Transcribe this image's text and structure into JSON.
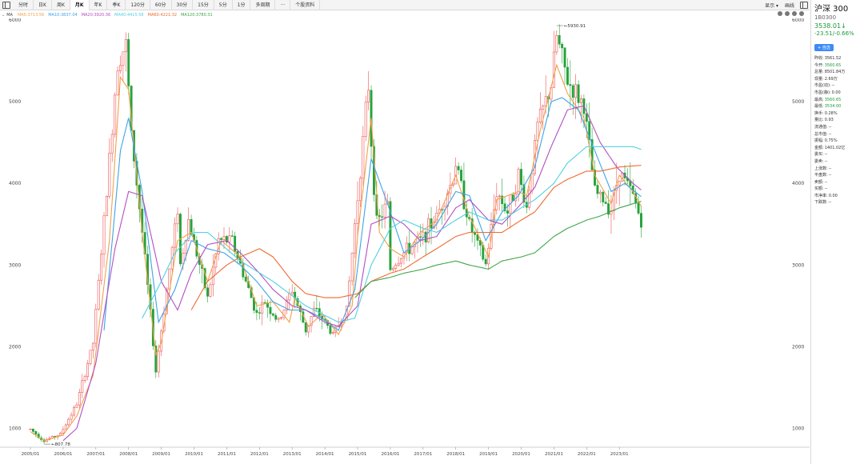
{
  "toolbar": {
    "tabs": [
      "分时",
      "日K",
      "周K",
      "月K",
      "年K",
      "季K",
      "120分",
      "60分",
      "30分",
      "15分",
      "5分",
      "1分",
      "多周期",
      "···",
      "个股资料"
    ],
    "active_index": 3,
    "right": [
      "显示 ▾",
      "画线"
    ]
  },
  "legend": {
    "label": "MA",
    "items": [
      {
        "text": "MA5:3713.56",
        "color": "#f2a14a"
      },
      {
        "text": "MA10:3837.04",
        "color": "#3ea3e8"
      },
      {
        "text": "MA20:3920.36",
        "color": "#b34fc2"
      },
      {
        "text": "MA40:4415.56",
        "color": "#4fd0e0"
      },
      {
        "text": "MA60:4221.32",
        "color": "#ef6a2f"
      },
      {
        "text": "MA120:3780.31",
        "color": "#3fa64a"
      }
    ]
  },
  "side": {
    "name": "沪深 300",
    "code": "1B0300",
    "price": "3538.01↓",
    "change": "-23.51/-0.66%",
    "add_label": "+ 自选",
    "rows": [
      {
        "k": "昨收:",
        "v": "3561.52",
        "green": false
      },
      {
        "k": "今开:",
        "v": "3560.65",
        "green": true
      },
      {
        "k": "总量:",
        "v": "8501.84万",
        "green": false
      },
      {
        "k": "现量:",
        "v": "2.69万",
        "green": false
      },
      {
        "k": "市盈(动):",
        "v": "--",
        "green": false
      },
      {
        "k": "市盈(静):",
        "v": "0.00",
        "green": false
      },
      {
        "k": "最高:",
        "v": "3560.65",
        "green": true
      },
      {
        "k": "最低:",
        "v": "3534.00",
        "green": true
      },
      {
        "k": "换手:",
        "v": "0.28%",
        "green": false
      },
      {
        "k": "量比:",
        "v": "0.93",
        "green": false
      },
      {
        "k": "流通值:",
        "v": "--",
        "green": false
      },
      {
        "k": "总市值:",
        "v": "--",
        "green": false
      },
      {
        "k": "振幅:",
        "v": "0.75%",
        "green": false
      },
      {
        "k": "金额:",
        "v": "1401.02亿",
        "green": false
      },
      {
        "k": "委买:",
        "v": "--",
        "green": false
      },
      {
        "k": "委卖:",
        "v": "--",
        "green": false
      },
      {
        "k": "上涨数:",
        "v": "--",
        "green": false
      },
      {
        "k": "平盘数:",
        "v": "--",
        "green": false
      },
      {
        "k": "卖额:",
        "v": "--",
        "green": false
      },
      {
        "k": "买额:",
        "v": "--",
        "green": false
      },
      {
        "k": "市净率:",
        "v": "0.00",
        "green": false
      },
      {
        "k": "下跌数:",
        "v": "--",
        "green": false
      }
    ]
  },
  "colors": {
    "up": "#ef5350",
    "down": "#26a33b"
  },
  "chart_data": {
    "type": "candlestick",
    "y_ticks": [
      1000,
      2000,
      3000,
      4000,
      5000,
      6000
    ],
    "x_ticks": [
      "2005/01",
      "2006/01",
      "2007/01",
      "2008/01",
      "2009/01",
      "2010/01",
      "2011/01",
      "2012/01",
      "2013/01",
      "2014/01",
      "2015/01",
      "2016/01",
      "2017/01",
      "2018/01",
      "2019/01",
      "2020/01",
      "2021/01",
      "2022/01",
      "2023/01"
    ],
    "annotations": [
      {
        "text": "807.78",
        "date": "2005/06",
        "value": 807.78
      },
      {
        "text": "5930.91",
        "date": "2021/02",
        "value": 5930.91
      }
    ],
    "ma_anchors": {
      "MA5": [
        [
          "2005/01",
          960
        ],
        [
          "2005/06",
          850
        ],
        [
          "2006/01",
          920
        ],
        [
          "2006/06",
          1150
        ],
        [
          "2006/12",
          1650
        ],
        [
          "2007/06",
          3300
        ],
        [
          "2007/10",
          5300
        ],
        [
          "2008/01",
          5150
        ],
        [
          "2008/06",
          3400
        ],
        [
          "2008/11",
          1900
        ],
        [
          "2009/01",
          2050
        ],
        [
          "2009/07",
          3300
        ],
        [
          "2009/12",
          3400
        ],
        [
          "2010/06",
          2800
        ],
        [
          "2010/11",
          3300
        ],
        [
          "2011/06",
          3100
        ],
        [
          "2011/12",
          2500
        ],
        [
          "2012/06",
          2550
        ],
        [
          "2012/12",
          2300
        ],
        [
          "2013/02",
          2600
        ],
        [
          "2013/07",
          2250
        ],
        [
          "2013/12",
          2400
        ],
        [
          "2014/06",
          2150
        ],
        [
          "2014/11",
          2500
        ],
        [
          "2015/01",
          3350
        ],
        [
          "2015/06",
          4800
        ],
        [
          "2015/09",
          3400
        ],
        [
          "2016/01",
          3200
        ],
        [
          "2016/06",
          3100
        ],
        [
          "2016/12",
          3400
        ],
        [
          "2017/06",
          3550
        ],
        [
          "2018/01",
          4100
        ],
        [
          "2018/06",
          3600
        ],
        [
          "2019/01",
          3100
        ],
        [
          "2019/04",
          3800
        ],
        [
          "2019/12",
          3900
        ],
        [
          "2020/03",
          3850
        ],
        [
          "2020/08",
          4650
        ],
        [
          "2021/02",
          5450
        ],
        [
          "2021/06",
          5100
        ],
        [
          "2021/12",
          4800
        ],
        [
          "2022/04",
          4100
        ],
        [
          "2022/10",
          3750
        ],
        [
          "2023/01",
          4100
        ],
        [
          "2023/06",
          3900
        ],
        [
          "2023/09",
          3720
        ]
      ],
      "MA10": [
        [
          "2007/04",
          2200
        ],
        [
          "2007/10",
          4400
        ],
        [
          "2008/01",
          4800
        ],
        [
          "2008/06",
          3900
        ],
        [
          "2008/12",
          2300
        ],
        [
          "2009/06",
          2700
        ],
        [
          "2009/12",
          3300
        ],
        [
          "2010/06",
          3200
        ],
        [
          "2010/12",
          3150
        ],
        [
          "2011/06",
          3000
        ],
        [
          "2011/12",
          2800
        ],
        [
          "2012/06",
          2550
        ],
        [
          "2012/12",
          2450
        ],
        [
          "2013/06",
          2450
        ],
        [
          "2013/12",
          2350
        ],
        [
          "2014/06",
          2200
        ],
        [
          "2014/12",
          2700
        ],
        [
          "2015/06",
          4300
        ],
        [
          "2015/12",
          3750
        ],
        [
          "2016/06",
          3150
        ],
        [
          "2016/12",
          3300
        ],
        [
          "2017/06",
          3500
        ],
        [
          "2018/01",
          3900
        ],
        [
          "2018/06",
          3850
        ],
        [
          "2018/12",
          3300
        ],
        [
          "2019/06",
          3650
        ],
        [
          "2019/12",
          3850
        ],
        [
          "2020/06",
          4200
        ],
        [
          "2020/12",
          5000
        ],
        [
          "2021/04",
          5050
        ],
        [
          "2021/10",
          4900
        ],
        [
          "2022/04",
          4400
        ],
        [
          "2022/10",
          3900
        ],
        [
          "2023/03",
          4000
        ],
        [
          "2023/09",
          3837
        ]
      ],
      "MA20": [
        [
          "2006/01",
          850
        ],
        [
          "2006/06",
          1000
        ],
        [
          "2007/01",
          1800
        ],
        [
          "2007/08",
          3200
        ],
        [
          "2008/01",
          3900
        ],
        [
          "2008/06",
          3850
        ],
        [
          "2009/01",
          2800
        ],
        [
          "2009/07",
          2450
        ],
        [
          "2009/12",
          2900
        ],
        [
          "2010/06",
          3250
        ],
        [
          "2011/01",
          3300
        ],
        [
          "2011/06",
          3150
        ],
        [
          "2012/01",
          2900
        ],
        [
          "2012/06",
          2700
        ],
        [
          "2013/01",
          2500
        ],
        [
          "2013/06",
          2450
        ],
        [
          "2014/01",
          2300
        ],
        [
          "2014/06",
          2250
        ],
        [
          "2015/01",
          2500
        ],
        [
          "2015/06",
          3500
        ],
        [
          "2016/01",
          3600
        ],
        [
          "2016/06",
          3500
        ],
        [
          "2016/12",
          3300
        ],
        [
          "2017/06",
          3350
        ],
        [
          "2018/01",
          3700
        ],
        [
          "2018/06",
          3800
        ],
        [
          "2019/01",
          3550
        ],
        [
          "2019/06",
          3500
        ],
        [
          "2020/01",
          3750
        ],
        [
          "2020/06",
          3950
        ],
        [
          "2020/12",
          4450
        ],
        [
          "2021/06",
          4900
        ],
        [
          "2021/12",
          4950
        ],
        [
          "2022/06",
          4500
        ],
        [
          "2022/12",
          4200
        ],
        [
          "2023/06",
          4000
        ],
        [
          "2023/09",
          3920
        ]
      ],
      "MA40": [
        [
          "2008/06",
          2350
        ],
        [
          "2009/01",
          2800
        ],
        [
          "2009/06",
          3150
        ],
        [
          "2010/01",
          3400
        ],
        [
          "2010/06",
          3400
        ],
        [
          "2011/06",
          3050
        ],
        [
          "2012/06",
          2800
        ],
        [
          "2013/06",
          2500
        ],
        [
          "2014/06",
          2300
        ],
        [
          "2014/12",
          2350
        ],
        [
          "2015/06",
          3000
        ],
        [
          "2016/01",
          3450
        ],
        [
          "2016/06",
          3550
        ],
        [
          "2017/01",
          3450
        ],
        [
          "2017/06",
          3400
        ],
        [
          "2018/01",
          3550
        ],
        [
          "2018/06",
          3650
        ],
        [
          "2019/01",
          3550
        ],
        [
          "2019/06",
          3550
        ],
        [
          "2020/01",
          3700
        ],
        [
          "2020/06",
          3800
        ],
        [
          "2021/01",
          4000
        ],
        [
          "2021/06",
          4250
        ],
        [
          "2022/01",
          4450
        ],
        [
          "2022/06",
          4450
        ],
        [
          "2023/01",
          4450
        ],
        [
          "2023/06",
          4450
        ],
        [
          "2023/09",
          4415
        ]
      ],
      "MA60": [
        [
          "2009/12",
          2450
        ],
        [
          "2010/06",
          2800
        ],
        [
          "2011/01",
          3000
        ],
        [
          "2011/06",
          3100
        ],
        [
          "2012/01",
          3200
        ],
        [
          "2012/06",
          3100
        ],
        [
          "2013/01",
          2800
        ],
        [
          "2013/06",
          2650
        ],
        [
          "2014/01",
          2600
        ],
        [
          "2014/06",
          2600
        ],
        [
          "2015/01",
          2650
        ],
        [
          "2015/06",
          2800
        ],
        [
          "2016/01",
          2900
        ],
        [
          "2016/06",
          2950
        ],
        [
          "2017/01",
          3100
        ],
        [
          "2017/06",
          3200
        ],
        [
          "2018/01",
          3350
        ],
        [
          "2018/06",
          3400
        ],
        [
          "2019/01",
          3400
        ],
        [
          "2019/06",
          3400
        ],
        [
          "2020/01",
          3550
        ],
        [
          "2020/06",
          3650
        ],
        [
          "2021/01",
          3950
        ],
        [
          "2021/06",
          4050
        ],
        [
          "2022/01",
          4150
        ],
        [
          "2022/06",
          4150
        ],
        [
          "2023/01",
          4200
        ],
        [
          "2023/09",
          4221
        ]
      ],
      "MA120": [
        [
          "2014/12",
          2600
        ],
        [
          "2015/06",
          2800
        ],
        [
          "2016/01",
          2850
        ],
        [
          "2016/06",
          2900
        ],
        [
          "2017/01",
          2950
        ],
        [
          "2017/06",
          3000
        ],
        [
          "2018/01",
          3050
        ],
        [
          "2018/06",
          3000
        ],
        [
          "2019/01",
          2950
        ],
        [
          "2019/06",
          3050
        ],
        [
          "2020/01",
          3100
        ],
        [
          "2020/06",
          3150
        ],
        [
          "2021/01",
          3350
        ],
        [
          "2021/06",
          3450
        ],
        [
          "2022/01",
          3550
        ],
        [
          "2022/06",
          3600
        ],
        [
          "2023/01",
          3700
        ],
        [
          "2023/09",
          3780
        ]
      ]
    },
    "close_anchors": [
      [
        "2005/01",
        990
      ],
      [
        "2005/06",
        850
      ],
      [
        "2005/12",
        930
      ],
      [
        "2006/06",
        1300
      ],
      [
        "2006/12",
        2050
      ],
      [
        "2007/05",
        3900
      ],
      [
        "2007/09",
        5500
      ],
      [
        "2007/12",
        5700
      ],
      [
        "2008/02",
        4600
      ],
      [
        "2008/06",
        3400
      ],
      [
        "2008/09",
        2400
      ],
      [
        "2008/11",
        1700
      ],
      [
        "2009/01",
        2200
      ],
      [
        "2009/07",
        3700
      ],
      [
        "2009/08",
        3000
      ],
      [
        "2009/11",
        3550
      ],
      [
        "2010/06",
        2600
      ],
      [
        "2010/10",
        3300
      ],
      [
        "2011/03",
        3300
      ],
      [
        "2011/09",
        2700
      ],
      [
        "2011/12",
        2400
      ],
      [
        "2012/03",
        2550
      ],
      [
        "2012/08",
        2300
      ],
      [
        "2013/01",
        2700
      ],
      [
        "2013/06",
        2200
      ],
      [
        "2013/09",
        2450
      ],
      [
        "2013/12",
        2350
      ],
      [
        "2014/04",
        2150
      ],
      [
        "2014/09",
        2450
      ],
      [
        "2014/12",
        3500
      ],
      [
        "2015/05",
        5200
      ],
      [
        "2015/06",
        4500
      ],
      [
        "2015/08",
        3500
      ],
      [
        "2015/12",
        3750
      ],
      [
        "2016/01",
        2950
      ],
      [
        "2016/06",
        3150
      ],
      [
        "2016/12",
        3300
      ],
      [
        "2017/06",
        3600
      ],
      [
        "2017/12",
        4050
      ],
      [
        "2018/01",
        4250
      ],
      [
        "2018/06",
        3500
      ],
      [
        "2018/12",
        3000
      ],
      [
        "2019/04",
        3900
      ],
      [
        "2019/08",
        3650
      ],
      [
        "2019/12",
        4100
      ],
      [
        "2020/03",
        3700
      ],
      [
        "2020/07",
        4700
      ],
      [
        "2020/12",
        5200
      ],
      [
        "2021/02",
        5800
      ],
      [
        "2021/06",
        5250
      ],
      [
        "2021/12",
        4950
      ],
      [
        "2022/04",
        3900
      ],
      [
        "2022/10",
        3700
      ],
      [
        "2023/01",
        4150
      ],
      [
        "2023/06",
        3850
      ],
      [
        "2023/09",
        3538
      ]
    ]
  }
}
